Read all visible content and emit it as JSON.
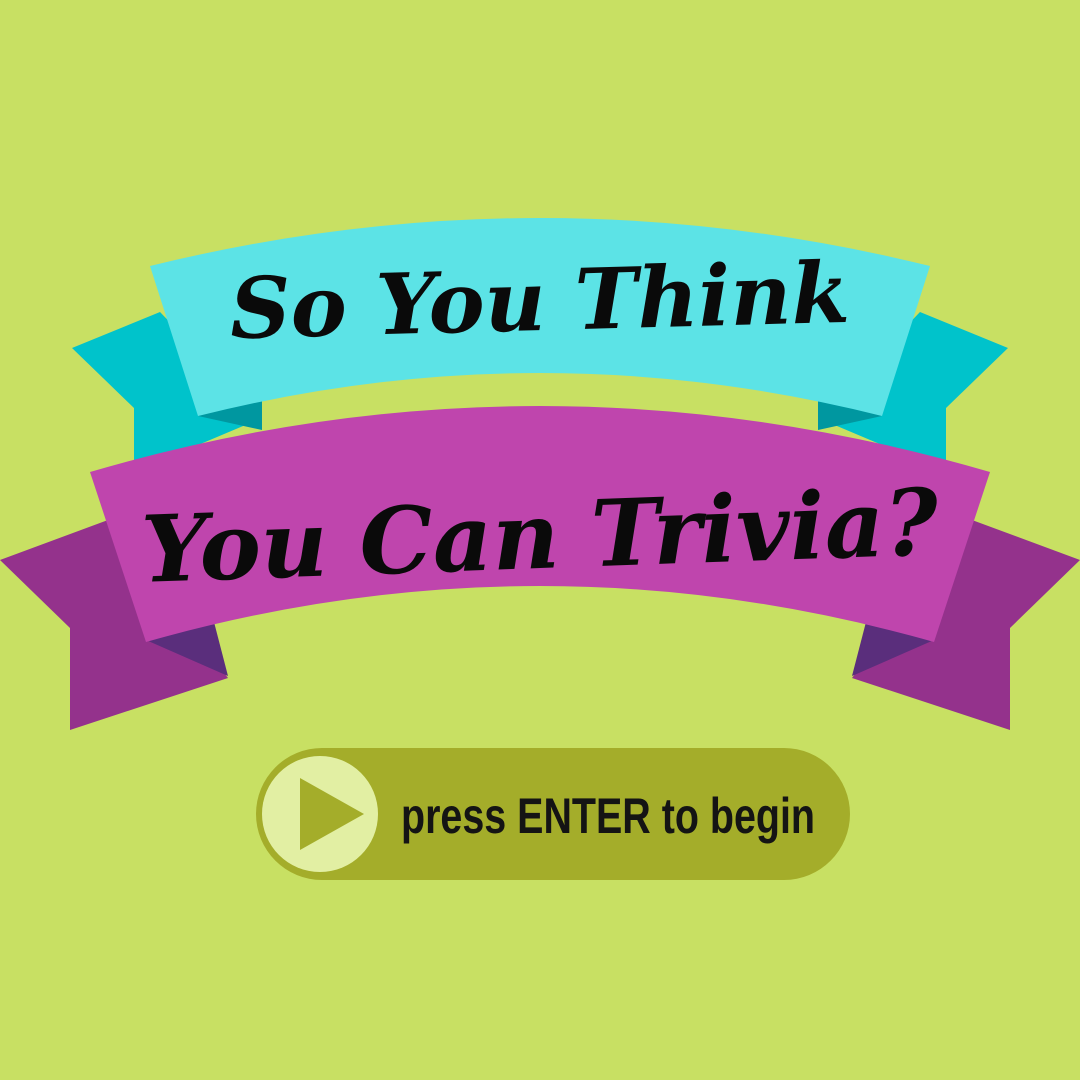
{
  "title": {
    "line1": "So You Think",
    "line2": "You Can Trivia?"
  },
  "start_button": {
    "label": "press ENTER to begin",
    "icon": "play-icon"
  },
  "colors": {
    "background": "#c8e063",
    "banner_top": "#5ce3e6",
    "banner_top_tail": "#00c3cb",
    "banner_top_fold": "#0097a0",
    "banner_bottom": "#bf45ad",
    "banner_bottom_tail": "#94328c",
    "banner_bottom_fold": "#5a2e7c",
    "button_fill": "#a4ad2a",
    "play_circle": "#e2efa3",
    "play_triangle": "#a4ad2a",
    "text": "#0a0a0a"
  }
}
